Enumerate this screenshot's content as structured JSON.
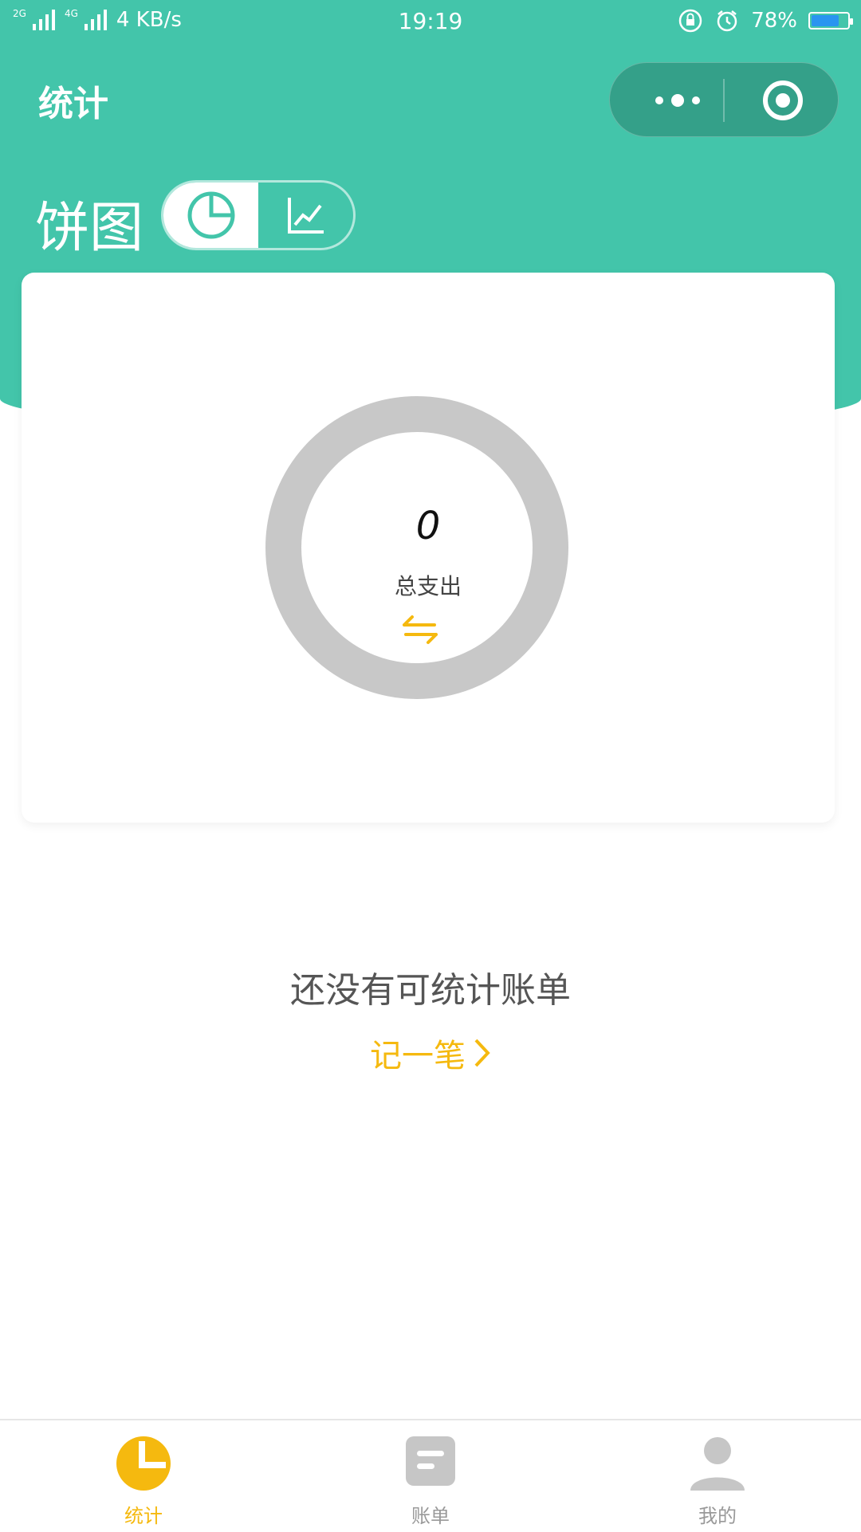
{
  "status_bar": {
    "network_1": "2G",
    "network_2": "4G",
    "speed": "4 KB/s",
    "time": "19:19",
    "battery_percent": "78%",
    "battery_level": 0.78
  },
  "nav": {
    "title": "统计",
    "menu_icon": "more-dots-icon",
    "close_icon": "target-close-icon"
  },
  "chart_header": {
    "title": "饼图",
    "toggle": [
      {
        "name": "pie-chart-icon",
        "active": true
      },
      {
        "name": "line-chart-icon",
        "active": false
      }
    ]
  },
  "summary": {
    "total_value": "0",
    "total_label": "总支出",
    "switch_icon": "swap-arrows-icon"
  },
  "empty_state": {
    "message": "还没有可统计账单",
    "link_label": "记一笔",
    "link_icon": "chevron-right-icon"
  },
  "tabbar": [
    {
      "label": "统计",
      "icon": "pie-chart-icon",
      "active": true
    },
    {
      "label": "账单",
      "icon": "bill-icon",
      "active": false
    },
    {
      "label": "我的",
      "icon": "user-icon",
      "active": false
    }
  ],
  "colors": {
    "primary": "#43c5aa",
    "accent": "#f5b90f",
    "ring": "#c8c8c8",
    "inactive": "#c6c6c6"
  }
}
